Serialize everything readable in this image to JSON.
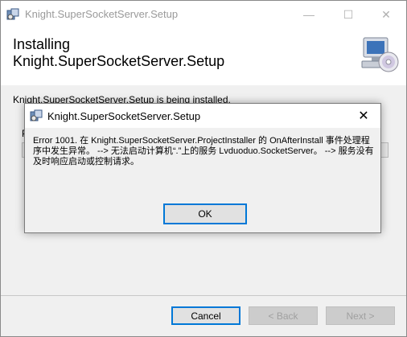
{
  "window": {
    "title": "Knight.SuperSocketServer.Setup",
    "controls": {
      "minimize": "—",
      "maximize": "☐",
      "close": "✕"
    }
  },
  "banner": {
    "title": "Installing\nKnight.SuperSocketServer.Setup",
    "graphic": "computer-cd-icon"
  },
  "body": {
    "status": "Knight.SuperSocketServer.Setup is being installed.",
    "progress_label_partial": "P",
    "progress_fraction": 0.0
  },
  "buttons": {
    "cancel": "Cancel",
    "back": "< Back",
    "next": "Next >"
  },
  "dialog": {
    "title": "Knight.SuperSocketServer.Setup",
    "close": "✕",
    "message": "Error 1001. 在 Knight.SuperSocketServer.ProjectInstaller 的 OnAfterInstall 事件处理程序中发生异常。 --> 无法启动计算机“.”上的服务 Lvduoduo.SocketServer。 --> 服务没有及时响应启动或控制请求。",
    "ok": "OK"
  },
  "colors": {
    "accent": "#0078d7",
    "progress": "#06b025",
    "dialog_bg": "#f0f0f0"
  }
}
